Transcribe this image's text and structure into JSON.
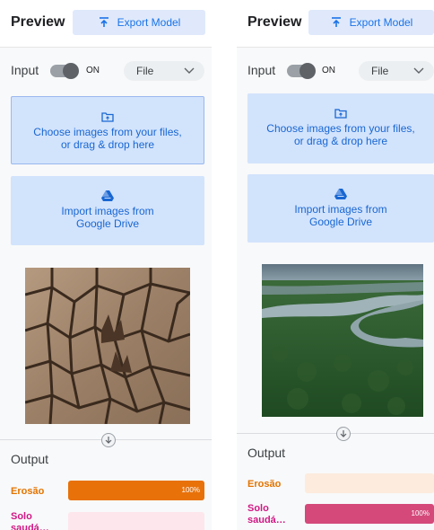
{
  "panels": [
    {
      "title": "Preview",
      "export_label": "Export Model",
      "input_label": "Input",
      "toggle_state": "ON",
      "source_select": "File",
      "files_box": {
        "line1": "Choose images from your files,",
        "line2": "or drag & drop here"
      },
      "drive_box": {
        "line1": "Import images from",
        "line2": "Google Drive"
      },
      "image": "cracked-dry-soil",
      "output_title": "Output",
      "classes": [
        {
          "label": "Erosão",
          "confidence": 1.0,
          "pct_label": "100%",
          "color": "#e8710a",
          "track": "#fde8d8"
        },
        {
          "label_line1": "Solo",
          "label_line2": "saudá…",
          "confidence": 0.0,
          "pct_label": "",
          "color": "#d4497a",
          "track": "#fde6ec"
        }
      ]
    },
    {
      "title": "Preview",
      "export_label": "Export Model",
      "input_label": "Input",
      "toggle_state": "ON",
      "source_select": "File",
      "files_box": {
        "line1": "Choose images from your files,",
        "line2": "or drag & drop here"
      },
      "drive_box": {
        "line1": "Import images from",
        "line2": "Google Drive"
      },
      "image": "forest-river-aerial",
      "output_title": "Output",
      "classes": [
        {
          "label": "Erosão",
          "confidence": 0.0,
          "pct_label": "",
          "color": "#e8710a",
          "track": "#fdebdd"
        },
        {
          "label_line1": "Solo",
          "label_line2": "saudá…",
          "confidence": 1.0,
          "pct_label": "100%",
          "color": "#d4497a",
          "track": "#fde6ec"
        }
      ]
    }
  ]
}
